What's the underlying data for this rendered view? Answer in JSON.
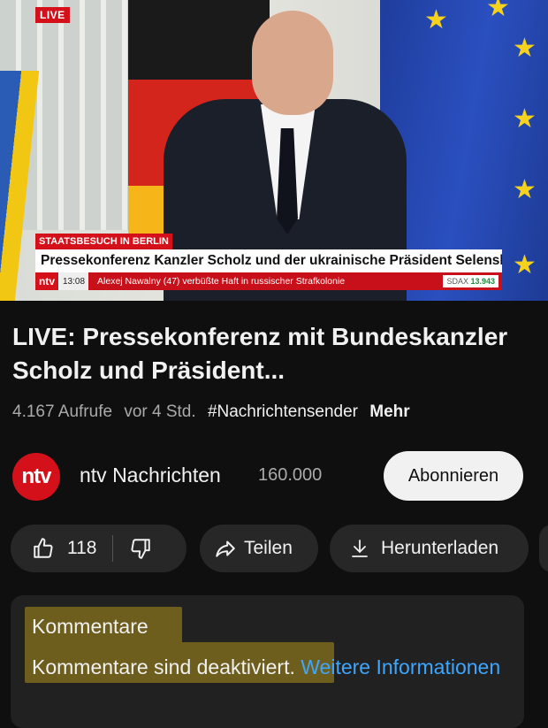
{
  "player": {
    "live_badge": "LIVE",
    "lower_third_tag": "STAATSBESUCH IN BERLIN",
    "lower_third_title": "Pressekonferenz Kanzler Scholz und der ukrainische Präsident Selenskyj",
    "ticker_logo": "ntv",
    "ticker_time": "13:08",
    "ticker_text": "Alexej Nawalny (47) verbüßte Haft in russischer Strafkolonie",
    "ticker_index_label": "SDAX",
    "ticker_index_value": "13.943"
  },
  "video": {
    "title": "LIVE: Pressekonferenz mit Bundeskanzler Scholz und Präsident...",
    "views": "4.167 Aufrufe",
    "age": "vor 4 Std.",
    "hashtag": "#Nachrichtensender",
    "more_label": "Mehr"
  },
  "channel": {
    "logo_text": "ntv",
    "name": "ntv Nachrichten",
    "subscribers": "160.000",
    "subscribe_label": "Abonnieren"
  },
  "actions": {
    "like_count": "118",
    "share_label": "Teilen",
    "download_label": "Herunterladen"
  },
  "comments": {
    "title": "Kommentare",
    "disabled_text": "Kommentare sind deaktiviert.",
    "info_link": "Weitere Informationen"
  },
  "colors": {
    "background": "#0f0f0f",
    "pill": "#272727",
    "link": "#3ea6ff",
    "ntv_red": "#d4111b",
    "highlight": "#e2c13a"
  }
}
